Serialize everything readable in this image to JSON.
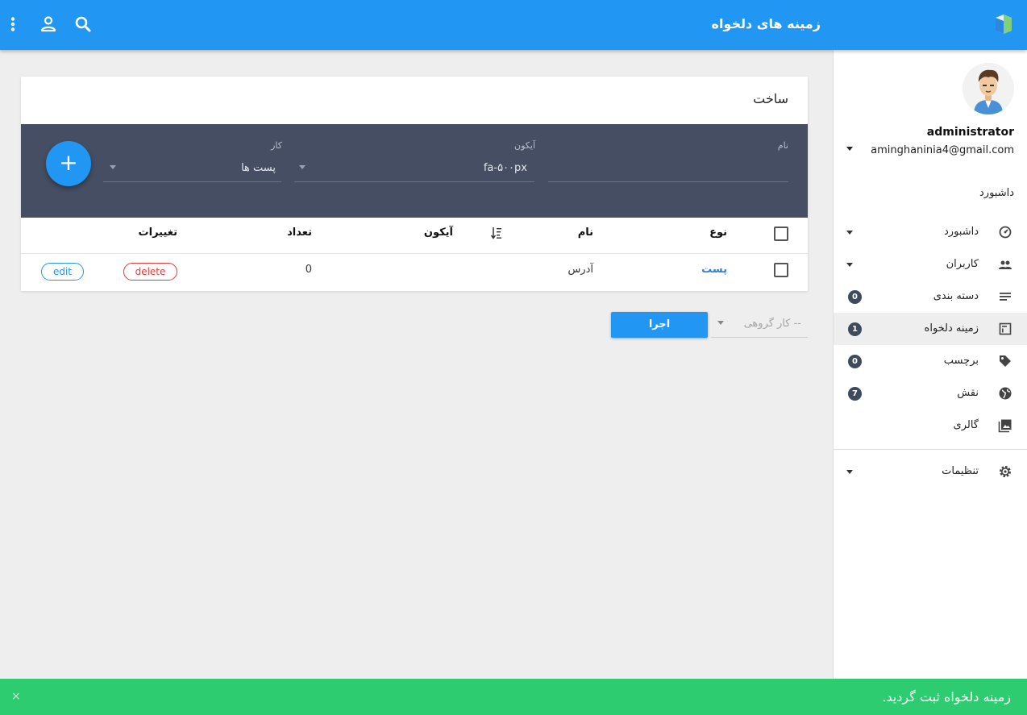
{
  "header": {
    "title": "زمینه های دلخواه"
  },
  "user": {
    "name": "administrator",
    "email": "aminghaninia4@gmail.com"
  },
  "sidebar": {
    "section_title": "داشبورد",
    "items": [
      {
        "label": "داشبورد",
        "icon": "speedometer-icon",
        "caret": true
      },
      {
        "label": "کاربران",
        "icon": "users-icon",
        "caret": true
      },
      {
        "label": "دسته بندی",
        "icon": "list-icon",
        "badge": "0"
      },
      {
        "label": "زمینه دلخواه",
        "icon": "custom-field-icon",
        "badge": "1",
        "active": true
      },
      {
        "label": "برچسب",
        "icon": "tag-icon",
        "badge": "0"
      },
      {
        "label": "نقش",
        "icon": "globe-icon",
        "badge": "7"
      },
      {
        "label": "گالری",
        "icon": "gallery-icon"
      },
      {
        "label": "تنظیمات",
        "icon": "gear-icon",
        "caret": true
      }
    ]
  },
  "card": {
    "title": "ساخت",
    "form": {
      "name_label": "نام",
      "name_value": "",
      "icon_label": "آیکون",
      "icon_value": "fa-۵۰۰px",
      "task_label": "کار",
      "task_value": "پست ها",
      "add_symbol": "+"
    },
    "table": {
      "headers": {
        "type": "نوع",
        "name": "نام",
        "icon": "آیکون",
        "count": "تعداد",
        "changes": "تغییرات"
      },
      "rows": [
        {
          "type": "پست",
          "name": "آدرس",
          "icon": "",
          "count": "0",
          "delete": "delete",
          "edit": "edit"
        }
      ]
    }
  },
  "bulk": {
    "placeholder": "-- کار گروهی",
    "run_label": "اجرا"
  },
  "snackbar": {
    "message": "زمینه دلخواه ثبت گردید.",
    "close": "×"
  },
  "colors": {
    "primary": "#2196f3",
    "form_band": "#454e62",
    "success": "#2ecc71",
    "danger": "#e53935",
    "badge": "#3f4a5c"
  }
}
